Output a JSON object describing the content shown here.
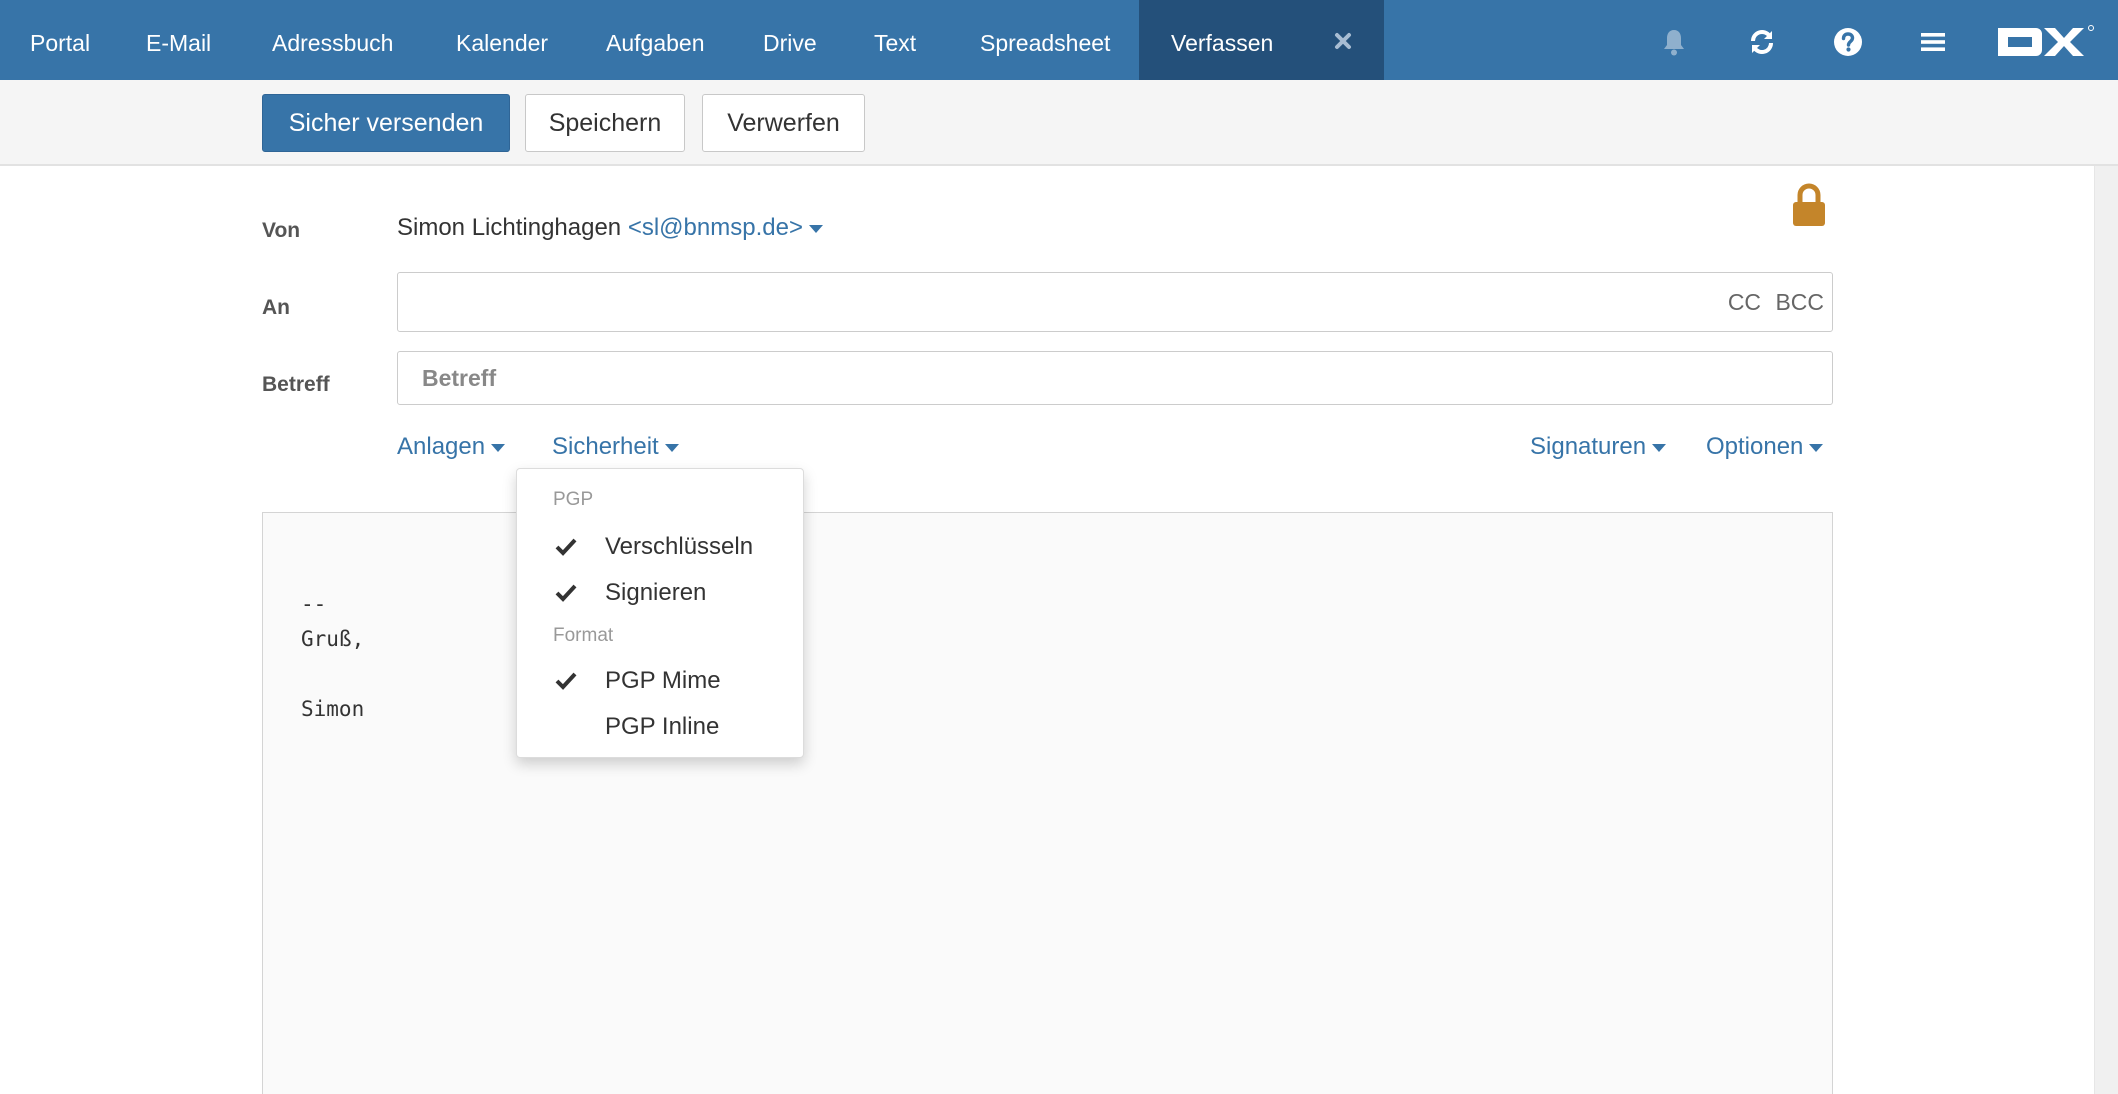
{
  "nav": {
    "apps": [
      {
        "label": "Portal"
      },
      {
        "label": "E-Mail"
      },
      {
        "label": "Adressbuch"
      },
      {
        "label": "Kalender"
      },
      {
        "label": "Aufgaben"
      },
      {
        "label": "Drive"
      },
      {
        "label": "Text"
      },
      {
        "label": "Spreadsheet"
      }
    ],
    "active_tab": {
      "label": "Verfassen",
      "close_icon": "close-icon"
    },
    "icons": [
      "bell-icon",
      "refresh-icon",
      "help-icon",
      "menu-icon"
    ],
    "logo": "OX"
  },
  "toolbar": {
    "send_label": "Sicher versenden",
    "save_label": "Speichern",
    "discard_label": "Verwerfen"
  },
  "compose": {
    "from_label": "Von",
    "from_name": "Simon Lichtinghagen",
    "from_email": "<sl@bnmsp.de>",
    "to_label": "An",
    "to_value": "",
    "cc_label": "CC",
    "bcc_label": "BCC",
    "subject_label": "Betreff",
    "subject_value": "",
    "subject_placeholder": "Betreff",
    "attachments_label": "Anlagen",
    "security_label": "Sicherheit",
    "signatures_label": "Signaturen",
    "options_label": "Optionen",
    "security_icon": "lock-icon",
    "body_lines": [
      "--",
      "Gruß,",
      "",
      "Simon"
    ]
  },
  "security_menu": {
    "pgp_header": "PGP",
    "encrypt_label": "Verschlüsseln",
    "encrypt_checked": true,
    "sign_label": "Signieren",
    "sign_checked": true,
    "format_header": "Format",
    "pgp_mime_label": "PGP Mime",
    "pgp_mime_checked": true,
    "pgp_inline_label": "PGP Inline",
    "pgp_inline_checked": false
  },
  "colors": {
    "topbar": "#3774a8",
    "active_tab": "#24507a",
    "primary_button": "#3774a8",
    "link": "#3774a8",
    "lock": "#c4852a",
    "bell_disabled": "#8fb0cd"
  }
}
